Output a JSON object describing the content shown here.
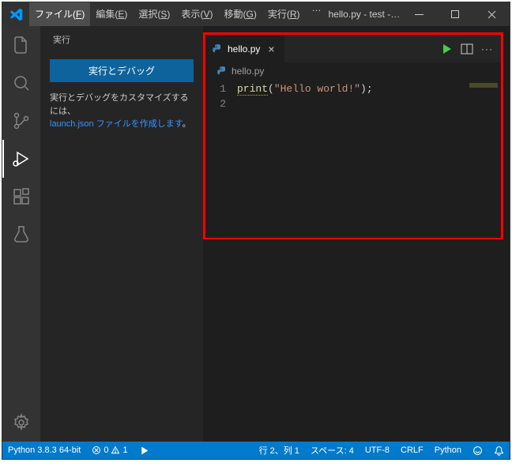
{
  "titlebar": {
    "menu": {
      "file": {
        "label": "ファイル",
        "key": "F"
      },
      "edit": {
        "label": "編集",
        "key": "E"
      },
      "select": {
        "label": "選択",
        "key": "S"
      },
      "view": {
        "label": "表示",
        "key": "V"
      },
      "go": {
        "label": "移動",
        "key": "G"
      },
      "run": {
        "label": "実行",
        "key": "R"
      },
      "more": "…"
    },
    "title": "hello.py - test - Visual Studi..."
  },
  "sidebar": {
    "title": "実行",
    "run_debug_button": "実行とデバッグ",
    "help_prefix": "実行とデバッグをカスタマイズするには、",
    "help_link": "launch.json ファイルを作成します",
    "help_suffix": "。"
  },
  "editor": {
    "tab_name": "hello.py",
    "breadcrumb_file": "hello.py",
    "lines": {
      "1": "1",
      "2": "2"
    },
    "code": {
      "fn": "print",
      "open": "(",
      "str": "\"Hello world!\"",
      "close": ");"
    }
  },
  "statusbar": {
    "python": "Python 3.8.3 64-bit",
    "errors": "0",
    "warnings": "1",
    "cursor": "行 2、列 1",
    "spaces": "スペース: 4",
    "encoding": "UTF-8",
    "eol": "CRLF",
    "language": "Python"
  }
}
